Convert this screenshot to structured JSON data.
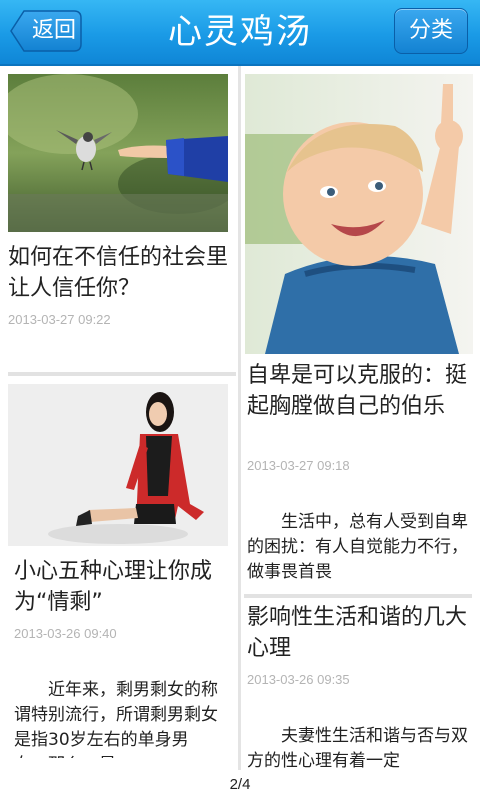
{
  "header": {
    "title": "心灵鸡汤",
    "back_label": "返回",
    "category_label": "分类"
  },
  "cards": {
    "c1": {
      "title": "如何在不信任的社会里让人信任你？",
      "date": "2013-03-27 09:22",
      "image": "bird-and-hand-photo"
    },
    "c2": {
      "title": "自卑是可以克服的：挺起胸膛做自己的伯乐",
      "date": "2013-03-27 09:18",
      "excerpt": "生活中，总有人受到自卑的困扰：有人自觉能力不行，做事畏首畏",
      "image": "smiling-baby-pointing-photo"
    },
    "c3": {
      "title": "小心五种心理让你成为“情剩”",
      "date": "2013-03-26 09:40",
      "excerpt": "近年来，剩男剩女的称谓特别流行，所谓剩男剩女是指30岁左右的单身男女，那么，是",
      "image": "woman-in-red-jacket-photo"
    },
    "c4": {
      "title": "影响性生活和谐的几大心理",
      "date": "2013-03-26 09:35",
      "excerpt": "夫妻性生活和谐与否与双方的性心理有着一定"
    }
  },
  "footer": {
    "page_indicator": "2/4"
  },
  "colors": {
    "header_blue": "#1a9ae6",
    "date_gray": "#b4b4b4",
    "divider_gray": "#e4e4e4"
  }
}
